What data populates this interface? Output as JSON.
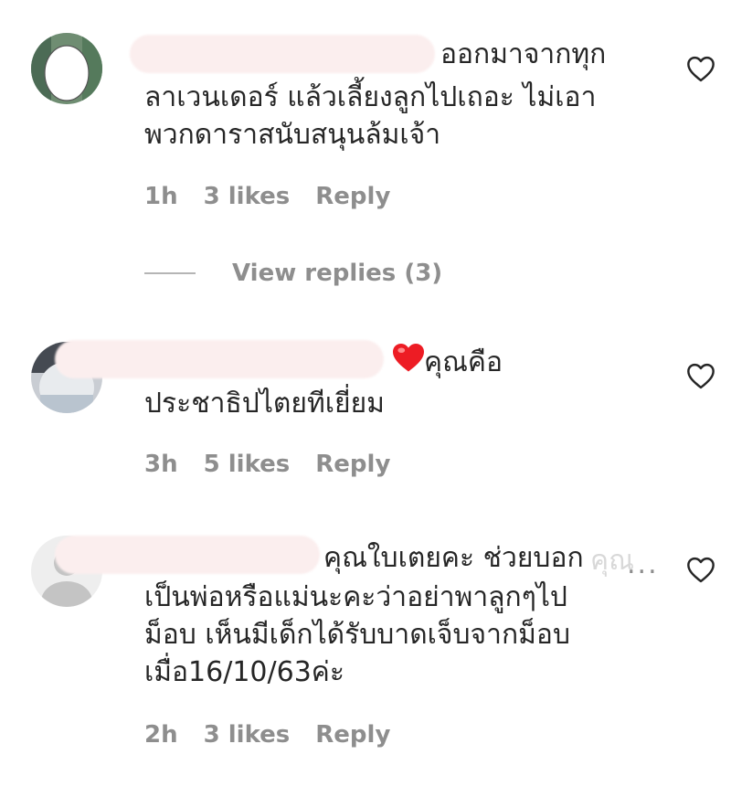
{
  "comments": [
    {
      "lines": [
        "ออกมาจากทุก",
        "ลาเวนเดอร์ แล้วเลี้ยงลูกไปเถอะ ไม่เอา",
        "พวกดาราสนับสนุนล้มเจ้า"
      ],
      "time": "1h",
      "likes": "3 likes",
      "reply": "Reply"
    },
    {
      "lines": [
        "คุณคือ",
        "ประชาธิปไตยทีเยี่ยม"
      ],
      "time": "3h",
      "likes": "5 likes",
      "reply": "Reply"
    },
    {
      "lines": [
        "คุณใบเตยคะ ช่วยบอก",
        "เป็นพ่อหรือแม่นะคะว่าอย่าพาลูกๆไป",
        "ม็อบ เห็นมีเด็กได้รับบาดเจ็บจากม็อบ",
        "เมื่อ16/10/63ค่ะ"
      ],
      "truncated_fragment": "คุณ",
      "more": "...",
      "time": "2h",
      "likes": "3 likes",
      "reply": "Reply"
    }
  ],
  "view_replies": "View replies (3)",
  "icons": {
    "like": "heart-outline-icon",
    "emoji": "red-heart-emoji-icon"
  },
  "colors": {
    "text": "#262626",
    "meta": "#8e8e8e",
    "heart": "#ed1c24"
  }
}
